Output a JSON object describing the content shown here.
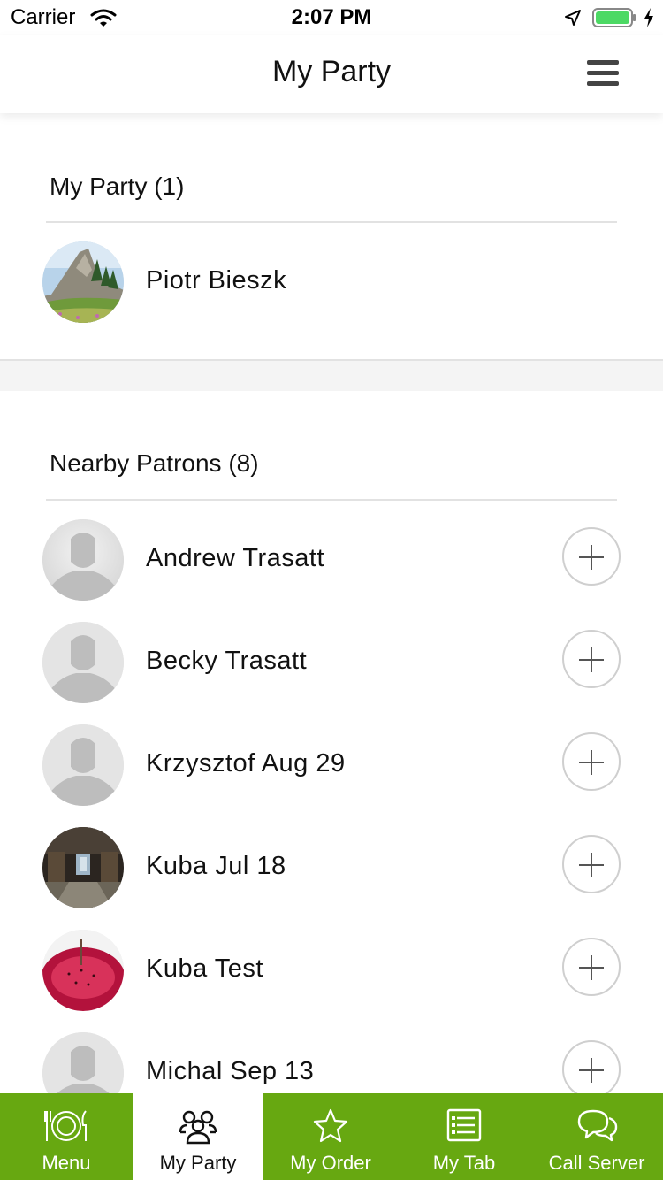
{
  "status_bar": {
    "carrier": "Carrier",
    "time": "2:07 PM"
  },
  "nav": {
    "title": "My Party",
    "menu_icon": "hamburger-icon"
  },
  "my_party": {
    "header": "My Party (1)",
    "members": [
      {
        "name": "Piotr Bieszk",
        "avatar": "mountain-photo"
      }
    ]
  },
  "nearby": {
    "header": "Nearby Patrons (8)",
    "patrons": [
      {
        "name": "Andrew Trasatt",
        "avatar": "default-silhouette"
      },
      {
        "name": "Becky Trasatt",
        "avatar": "default-silhouette"
      },
      {
        "name": "Krzysztof Aug 29",
        "avatar": "default-silhouette"
      },
      {
        "name": "Kuba Jul 18",
        "avatar": "stable-photo"
      },
      {
        "name": "Kuba Test",
        "avatar": "dragonfruit-photo"
      },
      {
        "name": "Michal Sep 13",
        "avatar": "default-silhouette"
      }
    ],
    "add_icon": "plus-circle-icon"
  },
  "tab_bar": {
    "tabs": [
      {
        "label": "Menu",
        "icon": "plate-cutlery-icon",
        "active": false
      },
      {
        "label": "My Party",
        "icon": "group-icon",
        "active": true
      },
      {
        "label": "My Order",
        "icon": "star-icon",
        "active": false
      },
      {
        "label": "My Tab",
        "icon": "list-icon",
        "active": false
      },
      {
        "label": "Call Server",
        "icon": "chat-bubbles-icon",
        "active": false
      }
    ]
  },
  "colors": {
    "accent": "#67a811",
    "divider": "#e2e2e2",
    "band": "#f4f4f4"
  }
}
